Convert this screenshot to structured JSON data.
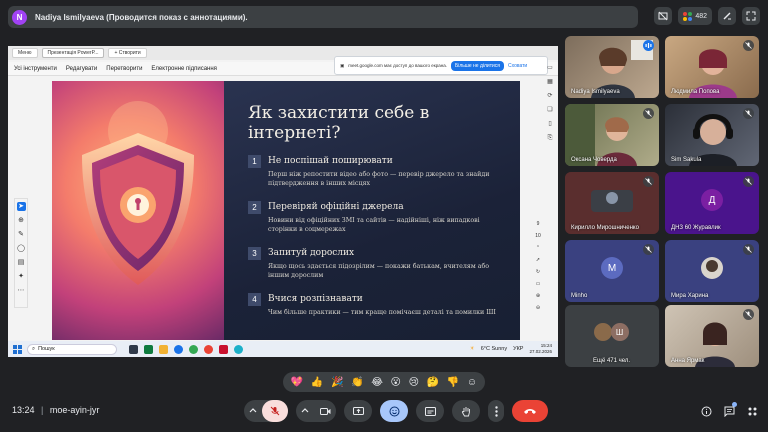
{
  "presenter": {
    "avatar_letter": "N",
    "label": "Nadiya Ismilyaeva (Проводится показ с аннотациями).",
    "participants_count": "482"
  },
  "shared_screen": {
    "app_tabs": [
      "Меню",
      "Презентація PowerP...",
      "+ Створити"
    ],
    "app_menu": [
      "Усі інструменти",
      "Редагувати",
      "Перетворити",
      "Електронне підписання"
    ],
    "share_banner": {
      "text": "meet.google.com має доступ до вашого екрана.",
      "stop_label": "Більше не ділитися",
      "hide_label": "Сховати"
    },
    "slide": {
      "title": "Як захистити себе в інтернеті?",
      "points": [
        {
          "num": "1",
          "title": "Не поспішай поширювати",
          "body": "Перш ніж репостити відео або фото — перевір джерело та знайди підтвердження в інших місцях"
        },
        {
          "num": "2",
          "title": "Перевіряй офіційні джерела",
          "body": "Новини від офіційних ЗМІ та сайтів — надійніші, ніж випадкові сторінки в соцмережах"
        },
        {
          "num": "3",
          "title": "Запитуй дорослих",
          "body": "Якщо щось здається підозрілим — покажи батькам, вчителям або іншим дорослим"
        },
        {
          "num": "4",
          "title": "Вчися розпізнавати",
          "body": "Чим більше практики — тим краще помічаєш деталі та помилки ШІ"
        }
      ]
    },
    "page_numbers": [
      "9",
      "10"
    ],
    "taskbar": {
      "search_placeholder": "Пошук",
      "weather": "6°C Sunny",
      "lang": "УКР",
      "time": "15:24",
      "date": "27.02.2026"
    }
  },
  "participants": [
    {
      "name": "Nadiya Ismilyaeva",
      "type": "video",
      "muted": false
    },
    {
      "name": "Людмила Попова",
      "type": "video",
      "muted": true
    },
    {
      "name": "Оксана Човерда",
      "type": "video",
      "muted": true
    },
    {
      "name": "Sim Sakula",
      "type": "video",
      "muted": true
    },
    {
      "name": "Кирилло Мирошниченко",
      "type": "video",
      "muted": true
    },
    {
      "name": "ДНЗ 60 Журавлик",
      "type": "letter",
      "letter": "Д",
      "color": "#7b1fa2",
      "muted": true
    },
    {
      "name": "Minho",
      "type": "letter",
      "letter": "M",
      "color": "#5c6bc0",
      "muted": true
    },
    {
      "name": "Мира Харина",
      "type": "video",
      "muted": true
    },
    {
      "name": "Ещё 471 чел.",
      "type": "more",
      "letter": "Ш"
    },
    {
      "name": "Анна Ярмак",
      "type": "video",
      "muted": true
    }
  ],
  "reactions": [
    "💖",
    "👍",
    "🎉",
    "👏",
    "😂",
    "😮",
    "😢",
    "🤔",
    "👎",
    "☺"
  ],
  "bottom": {
    "time": "13:24",
    "separator": "|",
    "meeting_code": "moe-ayin-jyr"
  },
  "colors": {
    "meet_bg": "#202124",
    "surface": "#3c4043",
    "end_call": "#ea4335",
    "accent_blue": "#1a73e8",
    "mic_off_bg": "#f9dedc"
  }
}
